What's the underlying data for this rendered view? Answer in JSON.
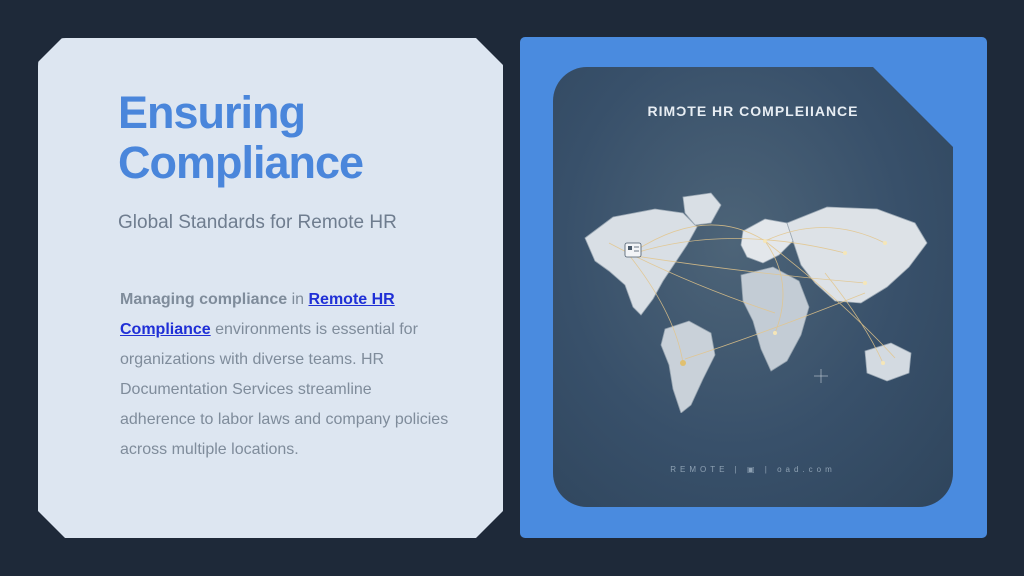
{
  "slide": {
    "title": "Ensuring Compliance",
    "subtitle": "Global Standards for Remote HR",
    "body": {
      "bold_lead": "Managing compliance",
      "connector": " in ",
      "link_text": "Remote HR Compliance",
      "rest": " environments is essential for organizations with diverse teams. HR Documentation Services streamline adherence to labor laws and company policies across multiple locations."
    }
  },
  "image": {
    "caption": "RIMƆTE HR COMPLEIIANCE",
    "footer": "REMOTE | ▣ | oad.com"
  },
  "colors": {
    "background": "#1e2939",
    "card": "#dde6f1",
    "accent": "#4a86db",
    "link": "#1f2fd6",
    "frame": "#4a8bdf"
  }
}
